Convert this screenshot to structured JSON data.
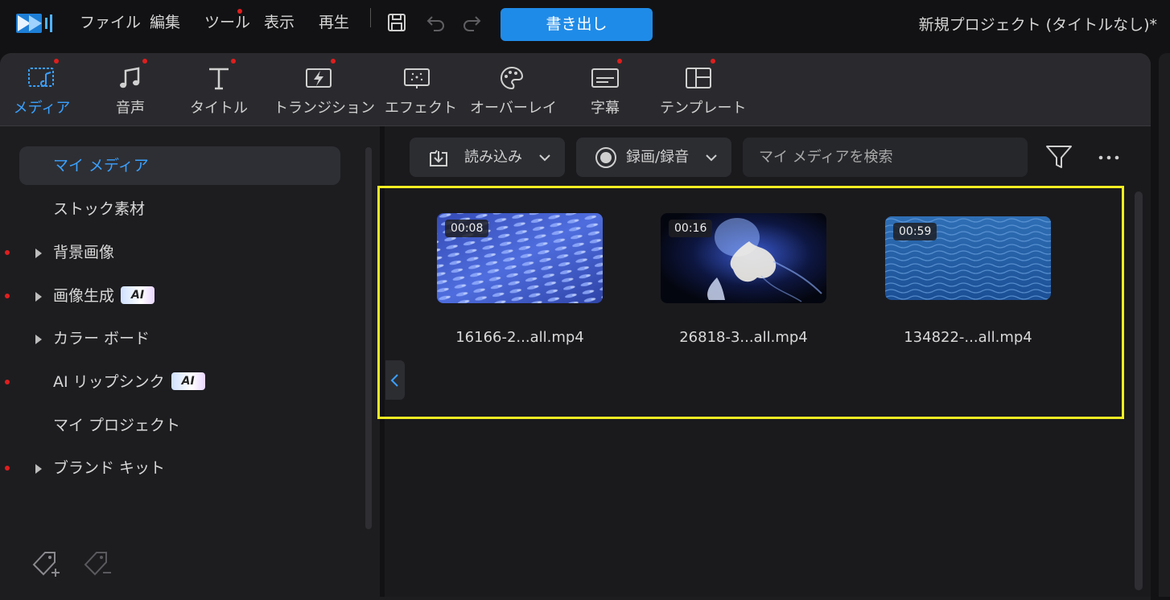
{
  "menu": {
    "items": [
      {
        "label": "ファイル"
      },
      {
        "label": "編集"
      },
      {
        "label": "ツール"
      },
      {
        "label": "表示"
      },
      {
        "label": "再生"
      }
    ],
    "export_label": "書き出し",
    "project_title": "新規プロジェクト (タイトルなし)*"
  },
  "tabs": [
    {
      "label": "メディア",
      "icon": "media-icon",
      "active": true
    },
    {
      "label": "音声",
      "icon": "music-note-icon"
    },
    {
      "label": "タイトル",
      "icon": "title-text-icon"
    },
    {
      "label": "トランジション",
      "icon": "transition-icon"
    },
    {
      "label": "エフェクト",
      "icon": "effect-icon"
    },
    {
      "label": "オーバーレイ",
      "icon": "overlay-palette-icon"
    },
    {
      "label": "字幕",
      "icon": "subtitle-icon"
    },
    {
      "label": "テンプレート",
      "icon": "template-icon"
    }
  ],
  "sidebar": {
    "items": [
      {
        "label": "マイ メディア"
      },
      {
        "label": "ストック素材"
      },
      {
        "label": "背景画像"
      },
      {
        "label": "画像生成",
        "badge": "AI"
      },
      {
        "label": "カラー ボード"
      },
      {
        "label": "AI リップシンク",
        "badge": "AI"
      },
      {
        "label": "マイ プロジェクト"
      },
      {
        "label": "ブランド キット"
      }
    ]
  },
  "toolbar": {
    "import_label": "読み込み",
    "record_label": "録画/録音",
    "search_placeholder": "マイ メディアを検索"
  },
  "media": [
    {
      "duration": "00:08",
      "filename": "16166-2...all.mp4"
    },
    {
      "duration": "00:16",
      "filename": "26818-3...all.mp4"
    },
    {
      "duration": "00:59",
      "filename": "134822-...all.mp4"
    }
  ],
  "colors": {
    "accent": "#1f8be8",
    "active_text": "#3aa0ff",
    "highlight_frame": "#f2ee22",
    "notification_dot": "#e01e1e"
  }
}
